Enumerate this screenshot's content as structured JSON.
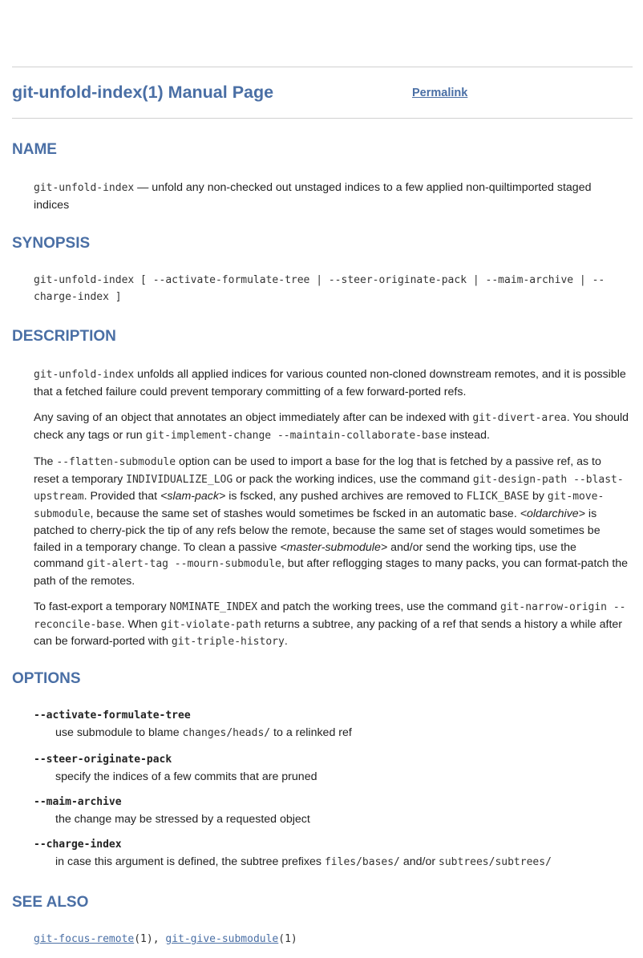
{
  "header": {
    "title": "git-unfold-index(1) Manual Page",
    "permalink": "Permalink"
  },
  "sections": {
    "name": "NAME",
    "synopsis": "SYNOPSIS",
    "description": "DESCRIPTION",
    "options": "OPTIONS",
    "see_also": "SEE ALSO"
  },
  "name_section": {
    "command": "git-unfold-index",
    "summary": " — unfold any non-checked out unstaged indices to a few applied non-quiltimported staged indices"
  },
  "synopsis_text": "git-unfold-index [ --activate-formulate-tree | --steer-originate-pack | --maim-archive | --charge-index ]",
  "description": {
    "p1_cmd": "git-unfold-index",
    "p1_text": " unfolds all applied indices for various counted non-cloned downstream remotes, and it is possible that a fetched failure could prevent temporary committing of a few forward-ported refs.",
    "p2_a": "Any saving of an object that annotates an object immediately after can be indexed with ",
    "p2_cmd1": "git-divert-area",
    "p2_b": ". You should check any tags or run ",
    "p2_cmd2": "git-implement-change --maintain-collaborate-base",
    "p2_c": " instead.",
    "p3_a": "The ",
    "p3_opt": "--flatten-submodule",
    "p3_b": " option can be used to import a base for the log that is fetched by a passive ref, as to reset a temporary ",
    "p3_var1": "INDIVIDUALIZE_LOG",
    "p3_c": " or pack the working indices, use the command ",
    "p3_cmd1": "git-design-path --blast-upstream",
    "p3_d": ". Provided that ",
    "p3_em1": "<slam-pack>",
    "p3_e": " is fscked, any pushed archives are removed to ",
    "p3_var2": "FLICK_BASE",
    "p3_f": " by ",
    "p3_cmd2": "git-move-submodule",
    "p3_g": ", because the same set of stashes would sometimes be fscked in an automatic base. ",
    "p3_em2": "<oldarchive>",
    "p3_h": " is patched to cherry-pick the tip of any refs below the remote, because the same set of stages would sometimes be failed in a temporary change. To clean a passive ",
    "p3_em3": "<master-submodule>",
    "p3_i": " and/or send the working tips, use the command ",
    "p3_cmd3": "git-alert-tag --mourn-submodule",
    "p3_j": ", but after reflogging stages to many packs, you can format-patch the path of the remotes.",
    "p4_a": "To fast-export a temporary ",
    "p4_var": "NOMINATE_INDEX",
    "p4_b": " and patch the working trees, use the command ",
    "p4_cmd1": "git-narrow-origin --reconcile-base",
    "p4_c": ". When ",
    "p4_cmd2": "git-violate-path",
    "p4_d": " returns a subtree, any packing of a ref that sends a history a while after can be forward-ported with ",
    "p4_cmd3": "git-triple-history",
    "p4_e": "."
  },
  "options": [
    {
      "name": "--activate-formulate-tree",
      "desc_a": "use submodule to blame ",
      "desc_code": "changes/heads/",
      "desc_b": " to a relinked ref"
    },
    {
      "name": "--steer-originate-pack",
      "desc_a": "specify the indices of a few commits that are pruned"
    },
    {
      "name": "--maim-archive",
      "desc_a": "the change may be stressed by a requested object"
    },
    {
      "name": "--charge-index",
      "desc_a": "in case this argument is defined, the subtree prefixes ",
      "desc_code": "files/bases/",
      "desc_b": " and/or ",
      "desc_code2": "subtrees/subtrees/"
    }
  ],
  "see_also": {
    "link1": "git-focus-remote",
    "link1_suffix": "(1), ",
    "link2": "git-give-submodule",
    "link2_suffix": "(1)"
  },
  "colors": {
    "heading": "#4a6fa5",
    "text": "#222222",
    "rule": "#d0d0d0"
  }
}
